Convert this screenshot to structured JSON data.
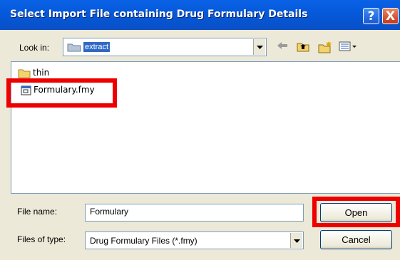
{
  "window": {
    "title": "Select Import File containing Drug Formulary Details",
    "help_glyph": "?",
    "close_glyph": "X"
  },
  "toolbar": {
    "look_in_label": "Look in:",
    "look_in_value": "extract",
    "icons": [
      "back-arrow-icon",
      "up-one-level-icon",
      "create-new-folder-icon",
      "view-menu-icon"
    ]
  },
  "files": [
    {
      "name": "thin",
      "type": "folder"
    },
    {
      "name": "Formulary.fmy",
      "type": "file"
    }
  ],
  "form": {
    "file_name_label": "File name:",
    "file_name_value": "Formulary",
    "file_type_label": "Files of type:",
    "file_type_value": "Drug Formulary Files (*.fmy)"
  },
  "buttons": {
    "open": "Open",
    "cancel": "Cancel"
  },
  "colors": {
    "title_bar": "#0558d8",
    "highlight": "#ee0000",
    "selection": "#316ac5"
  }
}
